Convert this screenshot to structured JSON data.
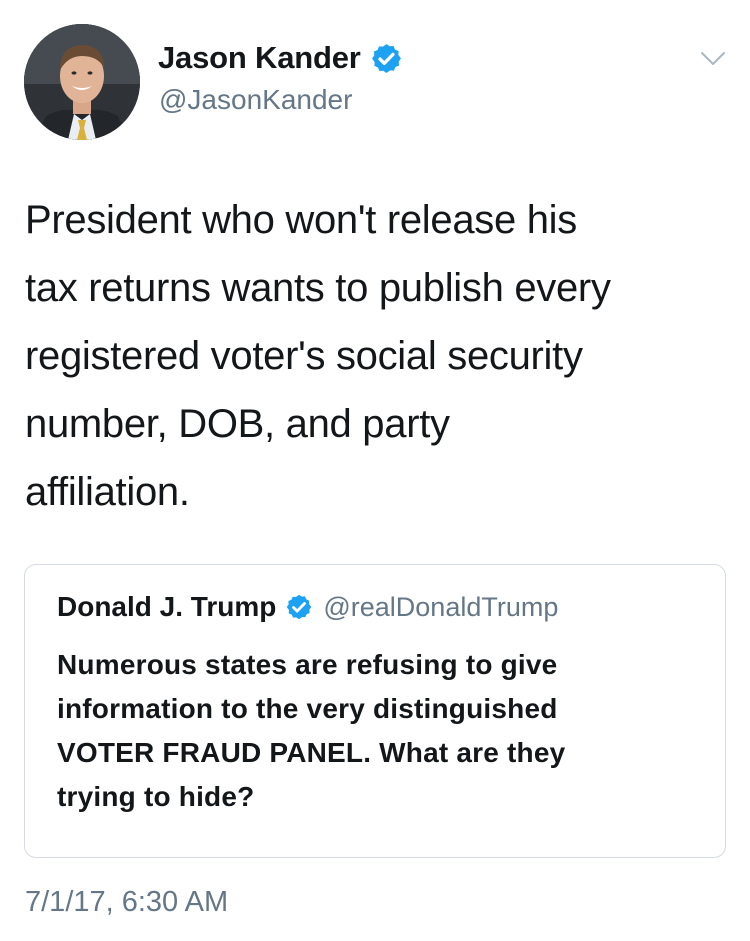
{
  "author": {
    "display_name": "Jason Kander",
    "handle": "@JasonKander",
    "verified": true
  },
  "tweet": {
    "text": "President who won't release his\ntax returns wants to publish every\nregistered voter's social security\nnumber, DOB, and party\naffiliation.",
    "timestamp": "7/1/17, 6:30 AM"
  },
  "quoted_tweet": {
    "display_name": "Donald J. Trump",
    "handle": "@realDonaldTrump",
    "verified": true,
    "text": "Numerous states are refusing to give\ninformation to the very distinguished\nVOTER FRAUD PANEL. What are they\ntrying to hide?"
  },
  "icons": {
    "avatar": "profile-photo",
    "verified": "verified-badge-icon",
    "menu": "chevron-down-icon"
  },
  "colors": {
    "text_primary": "#14171a",
    "text_secondary": "#657786",
    "verified_blue": "#1da1f2",
    "border": "#d5dbe0",
    "background": "#ffffff"
  }
}
